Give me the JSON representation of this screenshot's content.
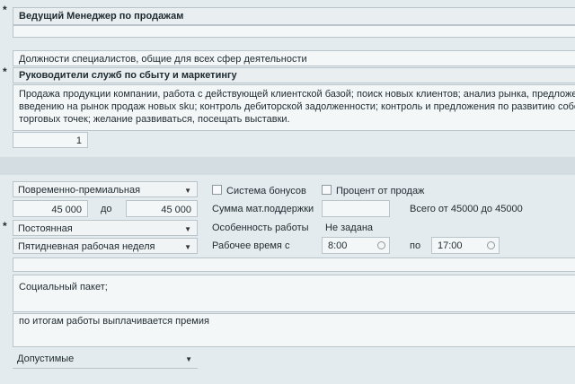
{
  "vacancy": {
    "title": "Ведущий Менеджер по продажам",
    "category": "Должности специалистов, общие для всех сфер деятельности",
    "subcategory": "Руководители служб по сбыту и маркетингу",
    "description_lines": [
      "Продажа продукции компании, работа с действующей клиентской базой; поиск новых клиентов; анализ рынка, предложения",
      "введению на рынок продаж новых sku; контроль дебиторской задолженности; контроль и предложения по развитию собств",
      "торговых точек; желание развиваться, посещать выставки."
    ],
    "count": "1",
    "required_mark": "*"
  },
  "salary": {
    "type": "Повременно-премиальная",
    "from": "45 000",
    "to_label": "до",
    "to": "45 000",
    "bonus_system_label": "Система бонусов",
    "sales_percent_label": "Процент от продаж",
    "material_support_label": "Сумма мат.поддержки",
    "material_support_value": "",
    "total_text": "Всего от 45000 до 45000"
  },
  "employment": {
    "type": "Постоянная",
    "work_feature_label": "Особенность работы",
    "work_feature_value": "Не задана",
    "schedule": "Пятидневная рабочая неделя",
    "work_time_label": "Рабочее время с",
    "time_from": "8:00",
    "time_to_label": "по",
    "time_to": "17:00"
  },
  "extra": {
    "social_package": "Социальный пакет;",
    "bonus_note": "по итогам работы выплачивается премия",
    "conditions": "Допустимые"
  }
}
